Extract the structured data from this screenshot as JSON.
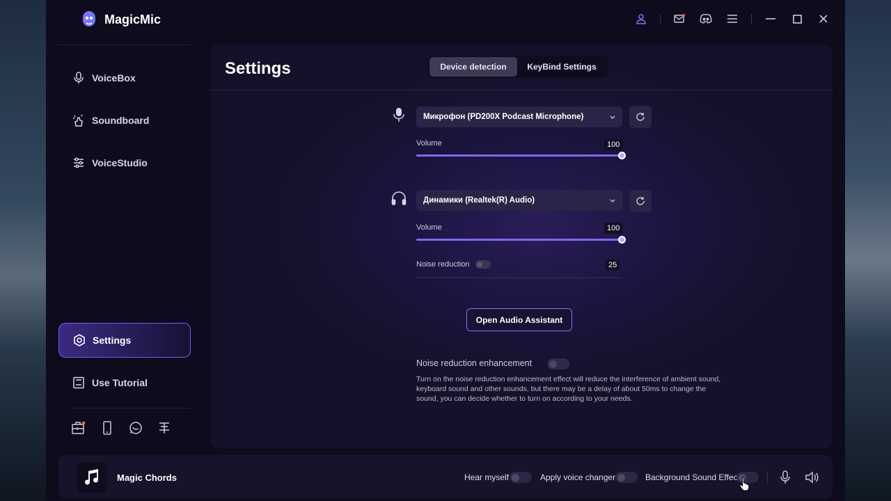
{
  "app": {
    "name": "MagicMic"
  },
  "sidebar": {
    "items": [
      {
        "label": "VoiceBox",
        "icon": "microphone-icon"
      },
      {
        "label": "Soundboard",
        "icon": "sparkle-hand-icon"
      },
      {
        "label": "VoiceStudio",
        "icon": "sliders-icon"
      },
      {
        "label": "Settings",
        "icon": "settings-icon",
        "active": true
      },
      {
        "label": "Use Tutorial",
        "icon": "book-icon"
      }
    ],
    "bottom_icons": [
      "toolbox-icon",
      "phone-icon",
      "chat-icon",
      "feedback-icon"
    ]
  },
  "page": {
    "title": "Settings"
  },
  "tabs": [
    {
      "label": "Device detection",
      "active": true
    },
    {
      "label": "KeyBind Settings",
      "active": false
    }
  ],
  "microphone": {
    "device": "Микрофон (PD200X Podcast Microphone)",
    "volume_label": "Volume",
    "volume": "100",
    "volume_fraction": 1.0
  },
  "speaker": {
    "device": "Динамики (Realtek(R) Audio)",
    "volume_label": "Volume",
    "volume": "100",
    "volume_fraction": 1.0,
    "noise_label": "Noise reduction",
    "noise_value": "25",
    "noise_enabled": false
  },
  "assistant_button": "Open Audio Assistant",
  "noise_enhancement": {
    "label": "Noise reduction enhancement",
    "enabled": false,
    "description": "Turn on the noise reduction enhancement effect will reduce the interference of ambient sound, keyboard sound and other sounds, but there may be a delay of about 50ms to change the sound, you can decide whether to turn on according to your needs."
  },
  "bottom_bar": {
    "track_name": "Magic Chords",
    "hear_myself": "Hear myself",
    "apply_voice_changer": "Apply voice changer",
    "background_sound": "Background Sound Effect"
  },
  "colors": {
    "accent": "#8a63f5",
    "background": "#0d0b1c",
    "panel": "#14122a"
  }
}
